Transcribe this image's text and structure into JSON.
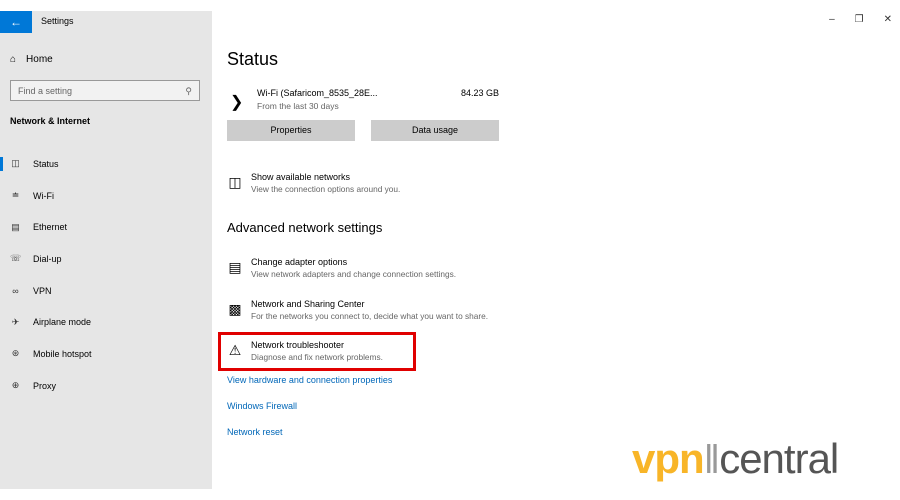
{
  "window": {
    "title": "Settings",
    "buttons": [
      "minimize",
      "restore",
      "close"
    ]
  },
  "sidebar": {
    "home": "Home",
    "search_placeholder": "Find a setting",
    "section": "Network & Internet",
    "items": [
      {
        "label": "Status",
        "icon": "status-globe-icon",
        "active": true
      },
      {
        "label": "Wi-Fi",
        "icon": "wifi-icon"
      },
      {
        "label": "Ethernet",
        "icon": "ethernet-icon"
      },
      {
        "label": "Dial-up",
        "icon": "dialup-icon"
      },
      {
        "label": "VPN",
        "icon": "vpn-icon"
      },
      {
        "label": "Airplane mode",
        "icon": "airplane-icon"
      },
      {
        "label": "Mobile hotspot",
        "icon": "hotspot-icon"
      },
      {
        "label": "Proxy",
        "icon": "globe-icon"
      }
    ]
  },
  "main": {
    "title": "Status",
    "connection": {
      "name": "Wi-Fi (Safaricom_8535_28E...",
      "sub": "From the last 30 days",
      "usage": "84.23 GB"
    },
    "buttons": {
      "properties": "Properties",
      "data_usage": "Data usage"
    },
    "show_networks": {
      "title": "Show available networks",
      "sub": "View the connection options around you."
    },
    "advanced_title": "Advanced network settings",
    "options": [
      {
        "title": "Change adapter options",
        "sub": "View network adapters and change connection settings."
      },
      {
        "title": "Network and Sharing Center",
        "sub": "For the networks you connect to, decide what you want to share."
      },
      {
        "title": "Network troubleshooter",
        "sub": "Diagnose and fix network problems."
      }
    ],
    "links": [
      "View hardware and connection properties",
      "Windows Firewall",
      "Network reset"
    ],
    "highlight_color": "#e00000"
  },
  "watermark": {
    "text": "vpncentral",
    "part1": "vpn",
    "part2": "central"
  }
}
